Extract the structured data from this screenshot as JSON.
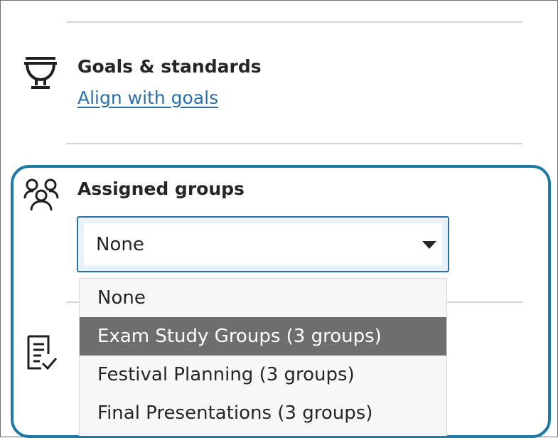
{
  "goals": {
    "heading": "Goals & standards",
    "link": "Align with goals",
    "icon": "trophy-icon"
  },
  "groups": {
    "heading": "Assigned groups",
    "icon": "people-icon",
    "select_value": "None",
    "options": [
      {
        "label": "None",
        "active": false
      },
      {
        "label": "Exam Study Groups (3 groups)",
        "active": true
      },
      {
        "label": "Festival Planning (3 groups)",
        "active": false
      },
      {
        "label": "Final Presentations (3 groups)",
        "active": false
      }
    ]
  },
  "rubric": {
    "icon": "clipboard-check-icon"
  },
  "colors": {
    "link": "#2a6fa8",
    "highlight": "#1f79a6",
    "active_option_bg": "#6e6e6e"
  }
}
